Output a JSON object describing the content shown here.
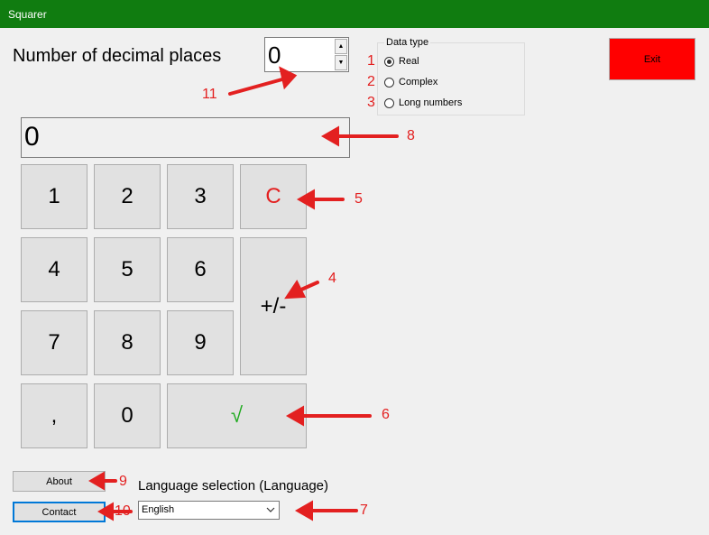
{
  "window": {
    "title": "Squarer"
  },
  "decimal_places": {
    "label": "Number of decimal places",
    "value": "0"
  },
  "data_type": {
    "legend": "Data type",
    "options": [
      {
        "label": "Real",
        "checked": true
      },
      {
        "label": "Complex",
        "checked": false
      },
      {
        "label": "Long numbers",
        "checked": false
      }
    ]
  },
  "exit_button": {
    "label": "Exit",
    "color": "#ff0000"
  },
  "display": {
    "value": "0"
  },
  "keypad": {
    "k1": "1",
    "k2": "2",
    "k3": "3",
    "clear": "C",
    "k4": "4",
    "k5": "5",
    "k6": "6",
    "plus_minus": "+/-",
    "k7": "7",
    "k8": "8",
    "k9": "9",
    "comma": ",",
    "k0": "0",
    "sqrt": "√",
    "clear_color": "#e32020",
    "sqrt_color": "#1faa1f"
  },
  "about_button": {
    "label": "About"
  },
  "contact_button": {
    "label": "Contact"
  },
  "language": {
    "label": "Language selection (Language)",
    "selected": "English"
  },
  "annotations": {
    "n1": "1",
    "n2": "2",
    "n3": "3",
    "n4": "4",
    "n5": "5",
    "n6": "6",
    "n7": "7",
    "n8": "8",
    "n9": "9",
    "n10": "10",
    "n11": "11",
    "color": "#e32020"
  }
}
